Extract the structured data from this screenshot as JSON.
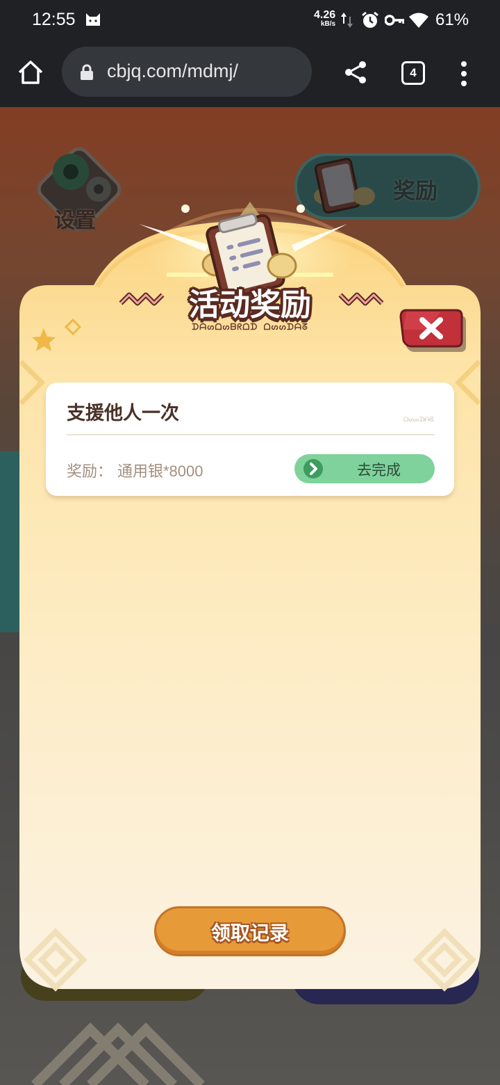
{
  "status_bar": {
    "time": "12:55",
    "net_rate_value": "4.26",
    "net_rate_unit": "kB/s",
    "battery": "61%",
    "icons": [
      "cat-notification-icon",
      "data-arrows-icon",
      "alarm-icon",
      "vpn-key-icon",
      "wifi-icon"
    ]
  },
  "browser": {
    "url": "cbjq.com/mdmj/",
    "tab_count": "4",
    "icons": [
      "home-icon",
      "lock-icon",
      "share-icon",
      "tabs-icon",
      "more-vert-icon"
    ]
  },
  "game_background": {
    "settings_label": "设置",
    "reward_button_label": "奖励"
  },
  "modal": {
    "title": "活动奖励",
    "subtitle": "ᗪᗩᔕᗝᔕᗷᖇᗝᗪ ᗝᔕᔕᗪᗩᘔ",
    "tasks": [
      {
        "title": "支援他人一次",
        "tag": "ᗝᔕᔕᗪᗩᘔ",
        "reward_label": "奖励：",
        "reward_value": "通用银*8000",
        "action_label": "去完成"
      }
    ],
    "record_button_label": "领取记录"
  },
  "colors": {
    "modal_top": "#fbd98a",
    "modal_bottom": "#fbf2e2",
    "go_button": "#7fd29c",
    "record_button": "#e79a38",
    "close_button": "#c2303a",
    "title_outline": "#5a2b22"
  }
}
